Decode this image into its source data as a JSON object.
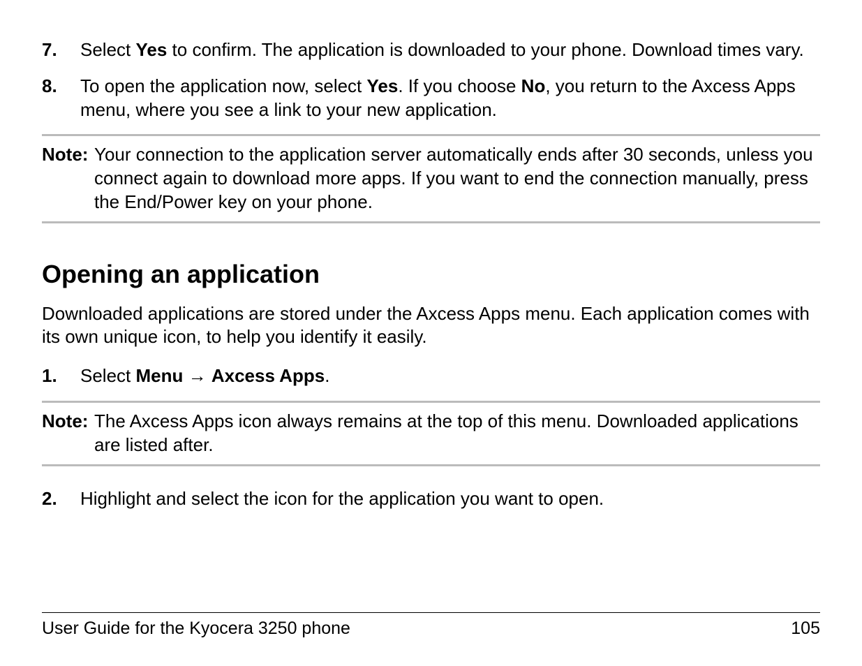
{
  "steps_first": [
    {
      "marker": "7.",
      "parts": [
        {
          "text": "Select ",
          "bold": false
        },
        {
          "text": "Yes",
          "bold": true
        },
        {
          "text": " to confirm. The application is downloaded to your phone. Download times vary.",
          "bold": false
        }
      ]
    },
    {
      "marker": "8.",
      "parts": [
        {
          "text": "To open the application now, select ",
          "bold": false
        },
        {
          "text": "Yes",
          "bold": true
        },
        {
          "text": ". If you choose ",
          "bold": false
        },
        {
          "text": "No",
          "bold": true
        },
        {
          "text": ", you return to the Axcess Apps menu, where you see a link to your new application.",
          "bold": false
        }
      ]
    }
  ],
  "note1": {
    "label": "Note:",
    "body": "Your connection to the application server automatically ends after 30 seconds, unless you connect again to download more apps. If you want to end the connection manually, press the End/Power key on your phone."
  },
  "section": {
    "heading": "Opening an application",
    "para": "Downloaded applications are stored under the Axcess Apps menu. Each application comes with its own unique icon, to help you identify it easily."
  },
  "step1": {
    "marker": "1.",
    "parts": [
      {
        "text": "Select ",
        "bold": false
      },
      {
        "text": "Menu",
        "bold": true
      },
      {
        "text": " → ",
        "bold": false
      },
      {
        "text": "Axcess Apps",
        "bold": true
      },
      {
        "text": ".",
        "bold": false
      }
    ]
  },
  "note2": {
    "label": "Note:",
    "body": "The Axcess Apps icon always remains at the top of this menu. Downloaded applications are listed after."
  },
  "step2": {
    "marker": "2.",
    "parts": [
      {
        "text": "Highlight and select the icon for the application you want to open.",
        "bold": false
      }
    ]
  },
  "footer": {
    "left": "User Guide for the Kyocera 3250 phone",
    "right": "105"
  }
}
